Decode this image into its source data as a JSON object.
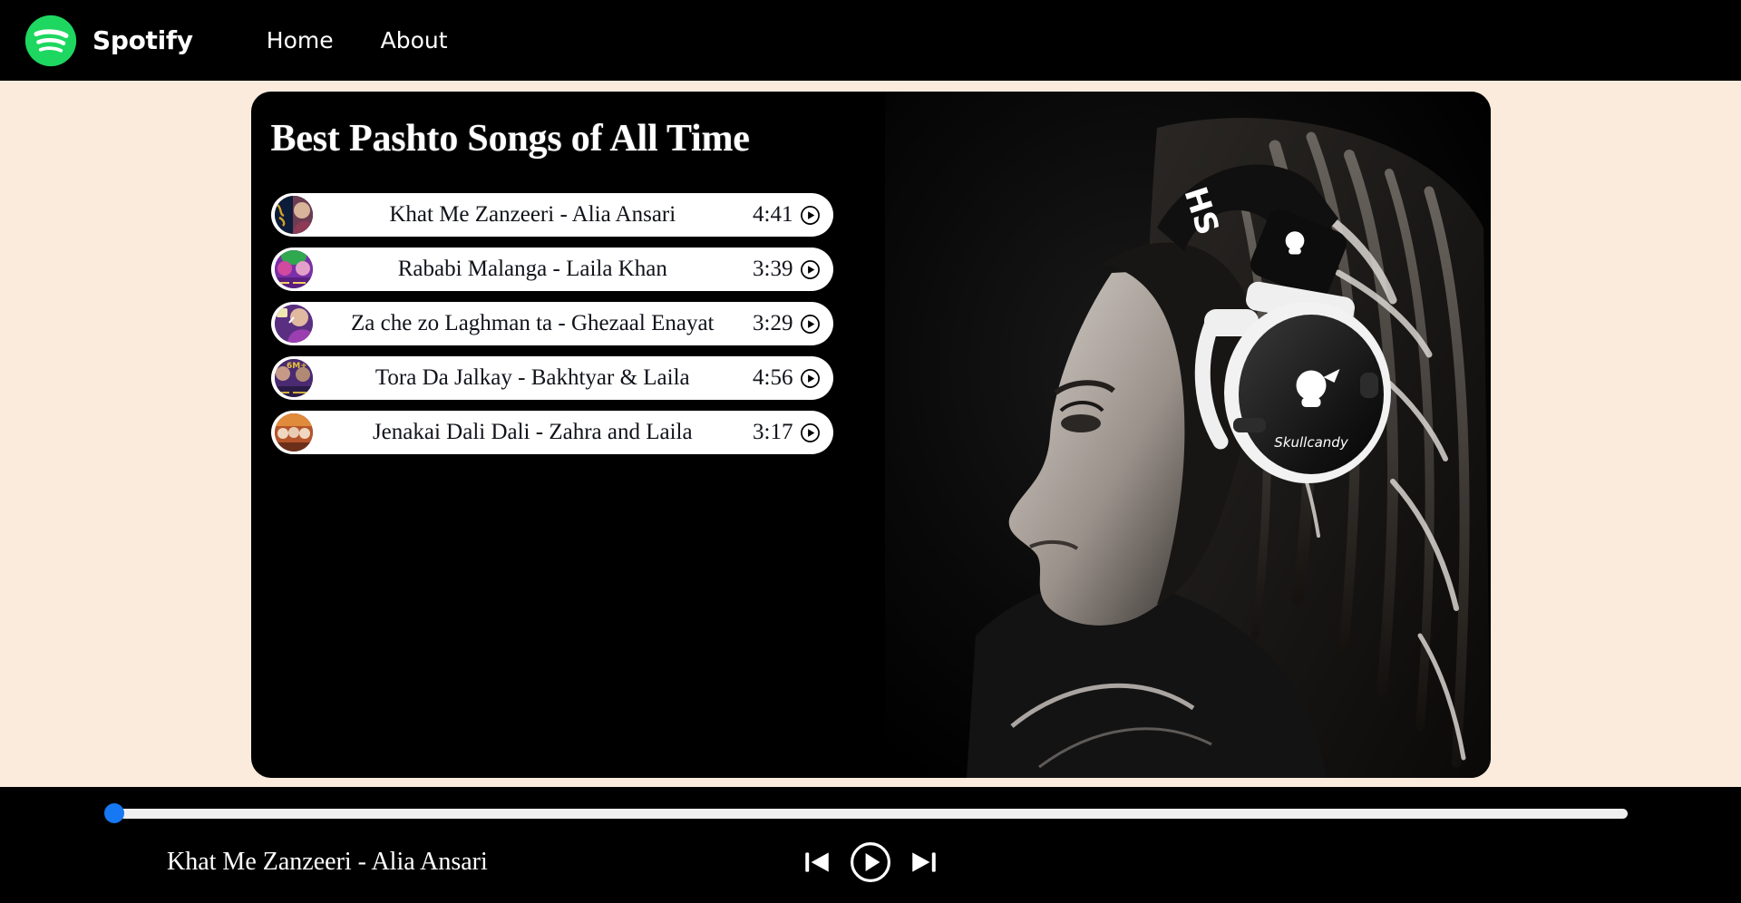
{
  "navbar": {
    "logo_icon": "spotify-logo-icon",
    "brand": "Spotify",
    "links": [
      {
        "label": "Home"
      },
      {
        "label": "About"
      }
    ]
  },
  "card": {
    "title": "Best Pashto Songs of All Time",
    "photo_alt": "woman-in-profile-wearing-skullcandy-headphones-black-and-white",
    "tracks": [
      {
        "title": "Khat Me Zanzeeri - Alia Ansari",
        "duration": "4:41",
        "play_icon": "play-circle-icon",
        "thumb_colors": [
          "#132a52",
          "#0d1c38",
          "#d4a12a"
        ]
      },
      {
        "title": "Rababi Malanga - Laila Khan",
        "duration": "3:39",
        "play_icon": "play-circle-icon",
        "thumb_colors": [
          "#2fa84f",
          "#7b2fa8",
          "#d14aa0"
        ]
      },
      {
        "title": "Za che zo Laghman ta - Ghezaal Enayat",
        "duration": "3:29",
        "play_icon": "play-circle-icon",
        "thumb_colors": [
          "#5a2f82",
          "#9b3fb0",
          "#d98fc8"
        ]
      },
      {
        "title": "Tora Da Jalkay - Bakhtyar & Laila",
        "duration": "4:56",
        "play_icon": "play-circle-icon",
        "thumb_colors": [
          "#4a2a70",
          "#2a1b46",
          "#e8c23a"
        ]
      },
      {
        "title": "Jenakai Dali Dali - Zahra and Laila",
        "duration": "3:17",
        "play_icon": "play-circle-icon",
        "thumb_colors": [
          "#b5552a",
          "#e08a3c",
          "#6b2f1a"
        ]
      }
    ]
  },
  "player": {
    "now_playing": "Khat Me Zanzeeri - Alia Ansari",
    "seek_percent": 0,
    "thumb_color": "#1678f2",
    "track_color": "#efefef",
    "prev_icon": "skip-back-icon",
    "play_icon": "play-circle-icon",
    "next_icon": "skip-forward-icon"
  },
  "theme": {
    "page_background": "#FAEBDC",
    "panel_background": "#000000",
    "accent_green": "#1ed760",
    "row_background": "#ffffff"
  }
}
